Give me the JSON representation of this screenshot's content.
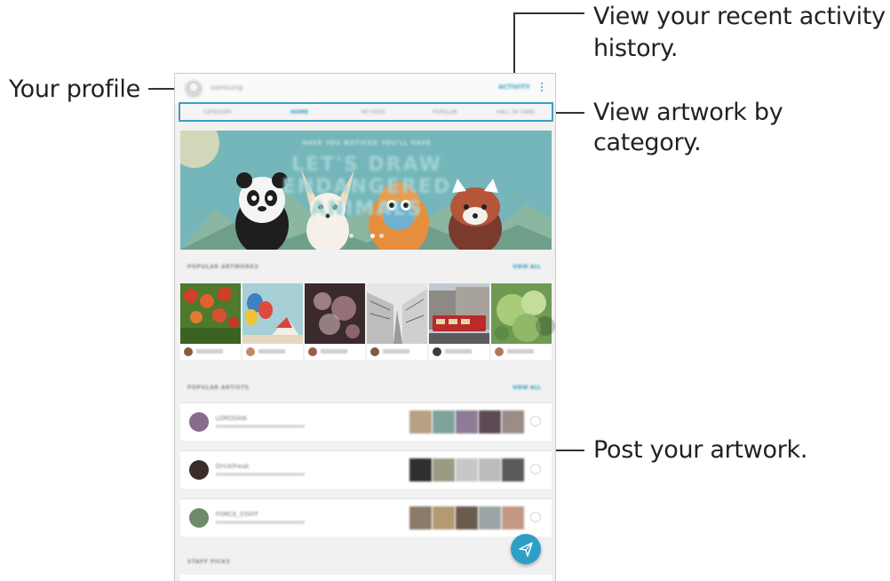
{
  "callouts": {
    "profile": "Your profile",
    "activity_line1": "View your recent activity",
    "activity_line2": "history.",
    "category": "View artwork by category.",
    "post": "Post your artwork."
  },
  "app": {
    "username": "samsung",
    "activity_label": "ACTIVITY",
    "tabs": [
      "CATEGORY",
      "HOME",
      "MY FEED",
      "POPULAR",
      "HALL OF FAME"
    ],
    "active_tab": "HOME",
    "banner": {
      "subtitle": "HAVE YOU NOTICED YOU'LL HAVE",
      "headline": "LET'S DRAW ENDANGERED ANIMALS",
      "page_indicator": "2 of 4"
    },
    "sections": {
      "popular_artworks": "POPULAR ARTWORKS",
      "popular_artists": "POPULAR ARTISTS",
      "staff_picks": "STAFF PICKS",
      "view_all": "VIEW ALL"
    },
    "artists": [
      {
        "name": "LORDDAN"
      },
      {
        "name": "DrinkFreak"
      },
      {
        "name": "FORCE_STAFF"
      }
    ]
  },
  "colors": {
    "accent": "#3a9fc6",
    "fab": "#2e9ec7",
    "banner_sky": "#74b6ba"
  },
  "icons": {
    "more": "more-vert-icon",
    "follow": "link-icon",
    "fab": "paper-plane-icon",
    "next": "chevron-right-icon"
  }
}
